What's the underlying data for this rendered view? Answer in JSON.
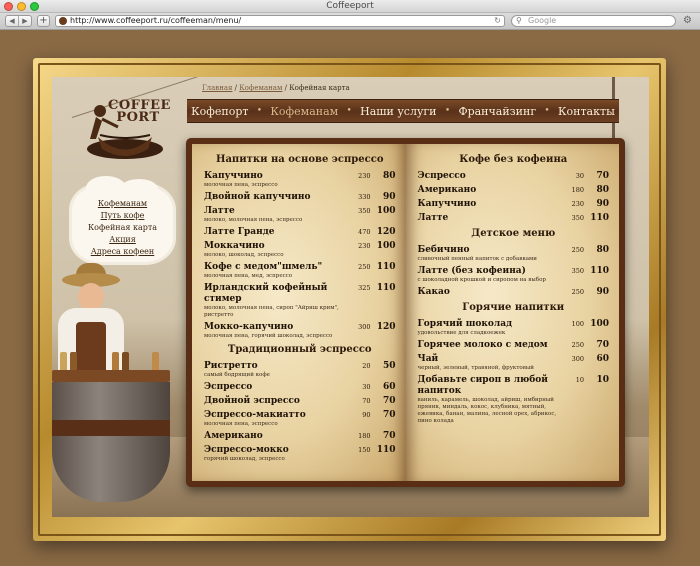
{
  "window": {
    "title": "Coffeeport"
  },
  "toolbar": {
    "url": "http://www.coffeeport.ru/coffeeman/menu/",
    "search_placeholder": "Google",
    "back_label": "◀",
    "forward_label": "▶",
    "add_label": "+",
    "reload_label": "↻",
    "search_icon_glyph": "⚲",
    "gear_glyph": "⚙"
  },
  "logo": {
    "line1": "COFFEE",
    "line2": "PORT"
  },
  "breadcrumb": {
    "home": "Главная",
    "sep": " / ",
    "section": "Кофеманам",
    "current": "Кофейная карта"
  },
  "nav": [
    "Кофепорт",
    "Кофеманам",
    "Наши услуги",
    "Франчайзинг",
    "Контакты"
  ],
  "nav_dot": "•",
  "side_menu": [
    {
      "label": "Кофеманам",
      "link": true
    },
    {
      "label": "Путь кофе",
      "link": true
    },
    {
      "label": "Кофейная карта",
      "link": false
    },
    {
      "label": "Акция",
      "link": true
    },
    {
      "label": "Адреса кофеен",
      "link": true
    }
  ],
  "menu": {
    "left": [
      {
        "title": "Напитки на основе эспрессо",
        "items": [
          {
            "name": "Капуччино",
            "desc": "молочная пена, эспрессо",
            "vol": "230",
            "price": "80"
          },
          {
            "name": "Двойной капуччино",
            "desc": "",
            "vol": "330",
            "price": "90"
          },
          {
            "name": "Латте",
            "desc": "молоко, молочная пена, эспрессо",
            "vol": "350",
            "price": "100"
          },
          {
            "name": "Латте Гранде",
            "desc": "",
            "vol": "470",
            "price": "120"
          },
          {
            "name": "Моккачино",
            "desc": "молоко, шоколад, эспрессо",
            "vol": "230",
            "price": "100"
          },
          {
            "name": "Кофе с медом\"шмель\"",
            "desc": "молочная пена, мед, эспрессо",
            "vol": "250",
            "price": "110"
          },
          {
            "name": "Ирландский кофейный стимер",
            "desc": "молоко, молочная пена, сироп \"Айриш крим\", ристретто",
            "vol": "325",
            "price": "110"
          },
          {
            "name": "Мокко-капучино",
            "desc": "молочная пена, горячий шоколад, эспрессо",
            "vol": "300",
            "price": "120"
          }
        ]
      },
      {
        "title": "Традиционный эспрессо",
        "items": [
          {
            "name": "Ристретто",
            "desc": "самый бодрящий кофе",
            "vol": "20",
            "price": "50"
          },
          {
            "name": "Эспрессо",
            "desc": "",
            "vol": "30",
            "price": "60"
          },
          {
            "name": "Двойной эспрессо",
            "desc": "",
            "vol": "70",
            "price": "70"
          },
          {
            "name": "Эспрессо-макиатто",
            "desc": "молочная пена, эспрессо",
            "vol": "90",
            "price": "70"
          },
          {
            "name": "Американо",
            "desc": "",
            "vol": "180",
            "price": "70"
          },
          {
            "name": "Эспрессо-мокко",
            "desc": "горячий шоколад, эспрессо",
            "vol": "150",
            "price": "110"
          }
        ]
      }
    ],
    "right": [
      {
        "title": "Кофе без кофеина",
        "items": [
          {
            "name": "Эспрессо",
            "desc": "",
            "vol": "30",
            "price": "70"
          },
          {
            "name": "Американо",
            "desc": "",
            "vol": "180",
            "price": "80"
          },
          {
            "name": "Капуччино",
            "desc": "",
            "vol": "230",
            "price": "90"
          },
          {
            "name": "Латте",
            "desc": "",
            "vol": "350",
            "price": "110"
          }
        ]
      },
      {
        "title": "Детское меню",
        "items": [
          {
            "name": "Бебичино",
            "desc": "сливочный пенный напиток с добавками",
            "vol": "250",
            "price": "80"
          },
          {
            "name": "Латте (без кофеина)",
            "desc": "с шоколадной крошкой и сиропом на выбор",
            "vol": "350",
            "price": "110"
          },
          {
            "name": "Какао",
            "desc": "",
            "vol": "250",
            "price": "90"
          }
        ]
      },
      {
        "title": "Горячие напитки",
        "items": [
          {
            "name": "Горячий шоколад",
            "desc": "удовольствие для сладкоежек",
            "vol": "100",
            "price": "100"
          },
          {
            "name": "Горячее молоко с медом",
            "desc": "",
            "vol": "250",
            "price": "70"
          },
          {
            "name": "Чай",
            "desc": "черный, зеленый, травяной, фруктовый",
            "vol": "300",
            "price": "60"
          },
          {
            "name": "Добавьте сироп в любой напиток",
            "desc": "ваниль, карамель, шоколад, айриш, имбирный пряник, миндаль, кокос, клубника, мятный, ежевика, банан, малина, лесной орех, абрикос, пино колада",
            "vol": "10",
            "price": "10"
          }
        ]
      }
    ]
  }
}
